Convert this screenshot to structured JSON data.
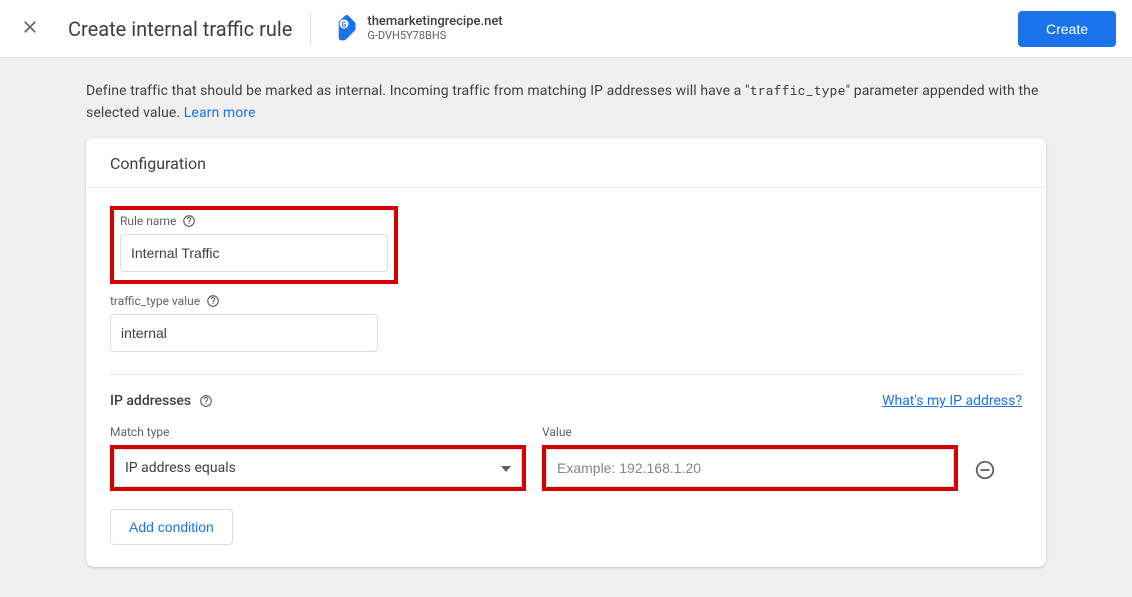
{
  "header": {
    "page_title": "Create internal traffic rule",
    "property_name": "themarketingrecipe.net",
    "property_id": "G-DVH5Y78BHS",
    "create_label": "Create"
  },
  "description": {
    "prefix": "Define traffic that should be marked as internal. Incoming traffic from matching IP addresses will have a \"",
    "param": "traffic_type",
    "suffix": "\" parameter appended with the selected value. ",
    "learn_more": "Learn more"
  },
  "card": {
    "title": "Configuration",
    "rule_name_label": "Rule name",
    "rule_name_value": "Internal Traffic",
    "traffic_type_label": "traffic_type value",
    "traffic_type_value": "internal",
    "ip_section_title": "IP addresses",
    "ip_help_link": "What's my IP address?",
    "match_type_label": "Match type",
    "match_type_value": "IP address equals",
    "value_label": "Value",
    "value_placeholder": "Example: 192.168.1.20",
    "add_condition_label": "Add condition"
  }
}
